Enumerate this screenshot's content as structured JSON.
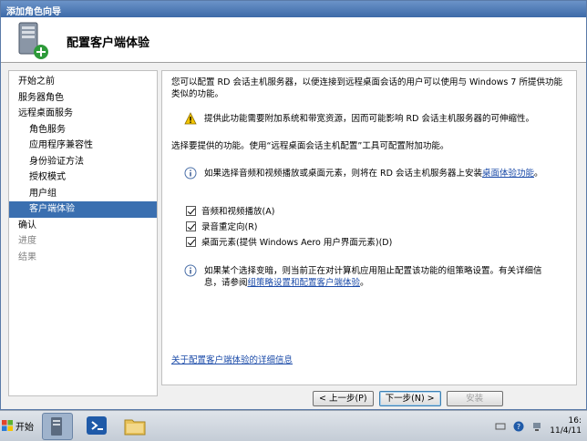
{
  "window": {
    "title": "添加角色向导"
  },
  "header": {
    "title": "配置客户端体验"
  },
  "sidebar": {
    "items": [
      {
        "label": "开始之前",
        "level": 0,
        "state": "normal"
      },
      {
        "label": "服务器角色",
        "level": 0,
        "state": "normal"
      },
      {
        "label": "远程桌面服务",
        "level": 0,
        "state": "normal"
      },
      {
        "label": "角色服务",
        "level": 1,
        "state": "normal"
      },
      {
        "label": "应用程序兼容性",
        "level": 1,
        "state": "normal"
      },
      {
        "label": "身份验证方法",
        "level": 1,
        "state": "normal"
      },
      {
        "label": "授权模式",
        "level": 1,
        "state": "normal"
      },
      {
        "label": "用户组",
        "level": 1,
        "state": "normal"
      },
      {
        "label": "客户端体验",
        "level": 1,
        "state": "active"
      },
      {
        "label": "确认",
        "level": 0,
        "state": "normal"
      },
      {
        "label": "进度",
        "level": 0,
        "state": "disabled"
      },
      {
        "label": "结果",
        "level": 0,
        "state": "disabled"
      }
    ]
  },
  "content": {
    "intro_line1": "您可以配置 RD 会话主机服务器，以便连接到远程桌面会话的用户可以使用与 Windows 7 所提供功能",
    "intro_line2": "类似的功能。",
    "warning": "提供此功能需要附加系统和带宽资源，因而可能影响 RD 会话主机服务器的可伸缩性。",
    "select_prompt": "选择要提供的功能。使用“远程桌面会话主机配置”工具可配置附加功能。",
    "info1_text": "如果选择音频和视频播放或桌面元素，则将在 RD 会话主机服务器上安装",
    "info1_link": "桌面体验功能",
    "info1_suffix": "。",
    "options": [
      {
        "label": "音频和视频播放(A)",
        "checked": true
      },
      {
        "label": "录音重定向(R)",
        "checked": true
      },
      {
        "label": "桌面元素(提供 Windows Aero 用户界面元素)(D)",
        "checked": true
      }
    ],
    "info2_line1": "如果某个选择变暗，则当前正在对计算机应用阻止配置该功能的组策略设置。有关详细信",
    "info2_prefix": "息，请参阅",
    "info2_link": "组策略设置和配置客户端体验",
    "info2_suffix": "。",
    "more_info_link": "关于配置客户端体验的详细信息"
  },
  "buttons": {
    "back": "< 上一步(P)",
    "next": "下一步(N) >",
    "install": "安装"
  },
  "taskbar": {
    "start_label": "开始",
    "time": "16:",
    "date": "11/4/11"
  },
  "colors": {
    "accent": "#3a6fb0",
    "link": "#1a4aa8",
    "title_bar": "#3d6aa8"
  }
}
